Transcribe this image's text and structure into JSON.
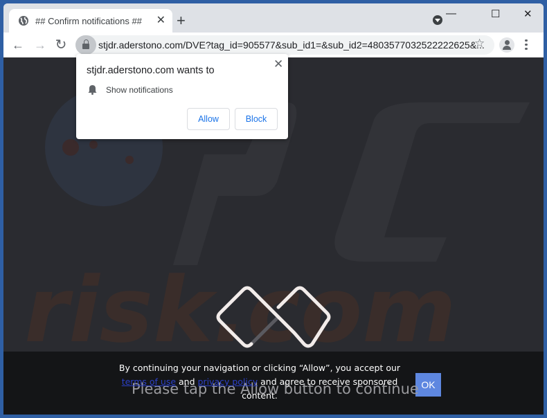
{
  "browser": {
    "tab": {
      "title": "## Confirm notifications ##",
      "close_glyph": "✕",
      "favicon": "globe-icon"
    },
    "new_tab_glyph": "+",
    "window_controls": {
      "minimize": "—",
      "maximize": "☐",
      "close": "✕"
    },
    "nav": {
      "back": "←",
      "forward": "→",
      "reload": "↻"
    },
    "url": "stjdr.aderstono.com/DVE?tag_id=905577&sub_id1=&sub_id2=4803577032522222625&...",
    "bookmark_glyph": "☆"
  },
  "permission_prompt": {
    "heading": "stjdr.aderstono.com wants to",
    "permission": "Show notifications",
    "close_glyph": "✕",
    "allow_label": "Allow",
    "block_label": "Block"
  },
  "page": {
    "watermark": "risk.com",
    "consent": {
      "text_before": "By continuing your navigation or clicking “Allow”, you accept our",
      "terms_link": "terms of use",
      "and": " and ",
      "privacy_link": "privacy policy",
      "text_after": " and agree to receive sponsored content.",
      "ok_label": "OK"
    },
    "prompt_text": "Please tap the Allow button to continue"
  },
  "colors": {
    "page_bg": "#2a2b30",
    "accent_blue": "#1a73e8",
    "ok_button": "#5e87e0"
  }
}
